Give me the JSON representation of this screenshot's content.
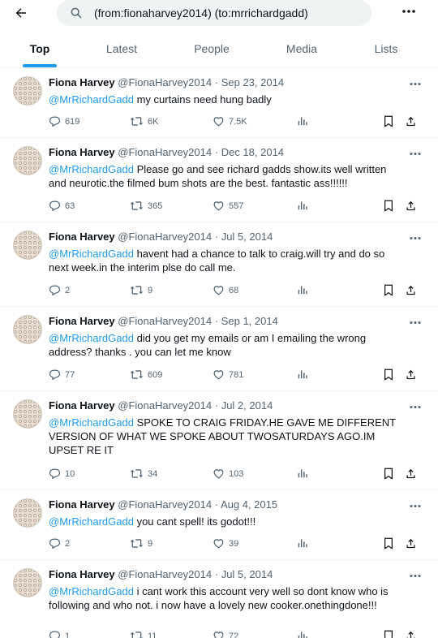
{
  "search": {
    "query": "(from:fionaharvey2014) (to:mrrichardgadd)"
  },
  "tabs": [
    {
      "label": "Top"
    },
    {
      "label": "Latest"
    },
    {
      "label": "People"
    },
    {
      "label": "Media"
    },
    {
      "label": "Lists"
    }
  ],
  "active_tab": "Top",
  "colors": {
    "accent": "#1d9bf0",
    "text": "#0f1419",
    "muted": "#536471",
    "divider": "#eff3f4",
    "search_bg": "#eff3f4"
  },
  "tweets": [
    {
      "name": "Fiona Harvey",
      "handle": "@FionaHarvey2014",
      "date": "Sep 23, 2014",
      "mention": "@MrRichardGadd",
      "text": "my curtains need hung badly",
      "replies": "619",
      "retweets": "6K",
      "likes": "7.5K"
    },
    {
      "name": "Fiona Harvey",
      "handle": "@FionaHarvey2014",
      "date": "Dec 18, 2014",
      "mention": "@MrRichardGadd",
      "text": "Please go and see richard gadds show.its well written and neurotic.the filmed bum shots are the best. fantastic ass!!!!!!",
      "replies": "63",
      "retweets": "365",
      "likes": "557"
    },
    {
      "name": "Fiona Harvey",
      "handle": "@FionaHarvey2014",
      "date": "Jul 5, 2014",
      "mention": "@MrRichardGadd",
      "text": "havent had a chance to talk to craig.will try and do so next week.in the interim plse do call me.",
      "replies": "2",
      "retweets": "9",
      "likes": "68"
    },
    {
      "name": "Fiona Harvey",
      "handle": "@FionaHarvey2014",
      "date": "Sep 1, 2014",
      "mention": "@MrRichardGadd",
      "text": "did you get my emails or am I emailing the wrong address? thanks . you can let me know",
      "replies": "77",
      "retweets": "609",
      "likes": "781"
    },
    {
      "name": "Fiona Harvey",
      "handle": "@FionaHarvey2014",
      "date": "Jul 2, 2014",
      "mention": "@MrRichardGadd",
      "text": "SPOKE TO CRAIG FRIDAY.HE GAVE ME DIFFERENT VERSION OF WHAT WE SPOKE ABOUT TWOSATURDAYS AGO.IM UPSET RE IT",
      "replies": "10",
      "retweets": "34",
      "likes": "103"
    },
    {
      "name": "Fiona Harvey",
      "handle": "@FionaHarvey2014",
      "date": "Aug 4, 2015",
      "mention": "@MrRichardGadd",
      "text": "you cant spell! its godot!!!",
      "replies": "2",
      "retweets": "9",
      "likes": "39"
    },
    {
      "name": "Fiona Harvey",
      "handle": "@FionaHarvey2014",
      "date": "Jul 5, 2014",
      "mention": "@MrRichardGadd",
      "text": "i cant work this account very well so dont know who is following and who not. i now have a lovely new cooker.onethingdone!!!",
      "replies": "1",
      "retweets": "11",
      "likes": "72"
    }
  ]
}
